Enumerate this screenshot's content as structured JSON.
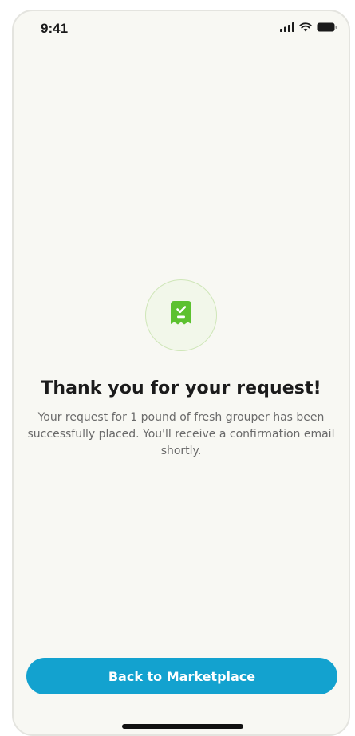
{
  "status_bar": {
    "time": "9:41",
    "icons": [
      "cellular-signal-icon",
      "wifi-icon",
      "battery-icon"
    ]
  },
  "confirmation": {
    "icon": "receipt-check-icon",
    "title": "Thank you for your request!",
    "message": "Your request for 1 pound of fresh grouper has been successfully placed. You'll receive a confirmation email shortly."
  },
  "actions": {
    "back_label": "Back to Marketplace"
  },
  "colors": {
    "background": "#f8f8f3",
    "accent_green": "#5cc12f",
    "button_blue": "#13a2cf"
  }
}
